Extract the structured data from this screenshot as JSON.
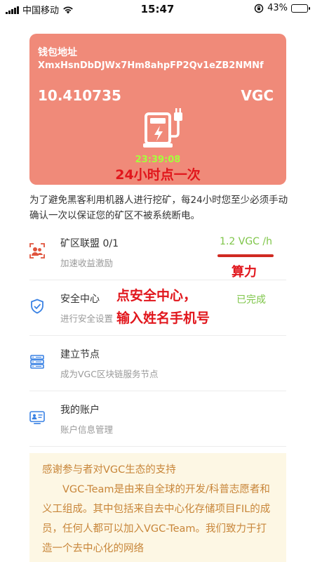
{
  "status_bar": {
    "carrier": "中国移动",
    "time": "15:47",
    "battery": "43%"
  },
  "wallet": {
    "address_label": "钱包地址",
    "address": "XmxHsnDbDJWx7Hm8ahpFP2Qv1eZB2NMNf",
    "balance": "10.410735",
    "unit": "VGC",
    "timer": "23:39:08",
    "annotation": "24小时点一次"
  },
  "description": "为了避免黑客利用机器人进行挖矿，每24小时您至少必须手动确认一次以保证您的矿区不被系统断电。",
  "menu": [
    {
      "title": "矿区联盟 0/1",
      "subtitle": "加速收益激励",
      "value": "1.2 VGC /h",
      "icon": "alliance-icon"
    },
    {
      "title": "安全中心",
      "subtitle": "进行安全设置",
      "value": "已完成",
      "icon": "shield-icon"
    },
    {
      "title": "建立节点",
      "subtitle": "成为VGC区块链服务节点",
      "icon": "server-node-icon"
    },
    {
      "title": "我的账户",
      "subtitle": "账户信息管理",
      "icon": "account-card-icon"
    }
  ],
  "annotations": {
    "hashrate": "算力",
    "security_line1": "点安全中心，",
    "security_line2": "输入姓名手机号"
  },
  "info": {
    "heading": "感谢参与者对VGC生态的支持",
    "body": "VGC-Team是由来自全球的开发/科普志愿者和义工组成。其中包括来自去中心化存储项目FIL的成员，任何人都可以加入VGC-Team。我们致力于打造一个去中心化的网络"
  },
  "colors": {
    "card": "#f08a79",
    "timer": "#a6ff3c",
    "annotation_red": "#e1161c",
    "completed_green": "#7ec548",
    "info_bg": "#fdf7e4",
    "info_text": "#c8863a"
  }
}
